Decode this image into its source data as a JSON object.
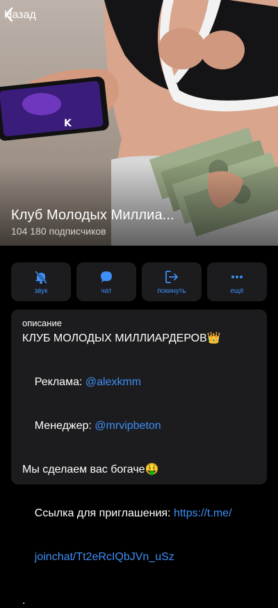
{
  "nav": {
    "back_label": "Назад"
  },
  "channel": {
    "title": "Клуб Молодых Миллиа...",
    "subscribers": "104 180 подписчиков"
  },
  "actions": [
    {
      "label": "звук",
      "icon": "bell-slash-icon"
    },
    {
      "label": "чат",
      "icon": "chat-bubble-icon"
    },
    {
      "label": "покинуть",
      "icon": "leave-icon"
    },
    {
      "label": "ещё",
      "icon": "more-icon"
    }
  ],
  "description": {
    "label": "описание",
    "title_line": "КЛУБ МОЛОДЫХ МИЛЛИАРДЕРОВ👑",
    "ads_prefix": "Реклама: ",
    "ads_handle": "@alexkmm",
    "manager_prefix": "Менеджер: ",
    "manager_handle": "@mrvipbeton",
    "promise": "Мы сделаем вас богаче🤑",
    "invite_prefix": "Ссылка для приглашения: ",
    "invite_link_part1": "https://t.me/",
    "invite_link_part2": "joinchat/Tt2eRcIQbJVn_uSz",
    "trailing": "."
  },
  "colors": {
    "accent": "#3e8ff5",
    "card_bg": "#1c1c1e",
    "page_bg": "#000000"
  }
}
